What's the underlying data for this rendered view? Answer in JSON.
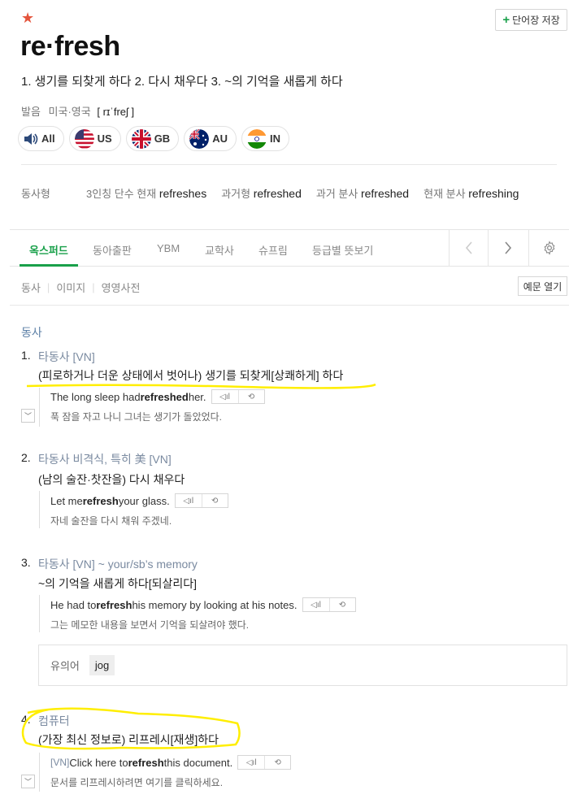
{
  "header": {
    "star": "★",
    "save_button": "단어장 저장",
    "save_plus": "+",
    "word": "re·fresh",
    "summary": "1. 생기를 되찾게 하다 2. 다시 채우다 3. ~의 기억을 새롭게 하다",
    "pron_label": "발음",
    "pron_region": "미국·영국",
    "pron_ipa": "[ rɪˈfreʃ ]",
    "audio": [
      {
        "label": "All",
        "icon": "speaker-icon"
      },
      {
        "label": "US",
        "icon": "us-flag-icon"
      },
      {
        "label": "GB",
        "icon": "gb-flag-icon"
      },
      {
        "label": "AU",
        "icon": "au-flag-icon"
      },
      {
        "label": "IN",
        "icon": "in-flag-icon"
      }
    ]
  },
  "verb_forms": {
    "label": "동사형",
    "items": [
      {
        "name": "3인칭 단수 현재",
        "value": "refreshes"
      },
      {
        "name": "과거형",
        "value": "refreshed"
      },
      {
        "name": "과거 분사",
        "value": "refreshed"
      },
      {
        "name": "현재 분사",
        "value": "refreshing"
      }
    ]
  },
  "tabs": [
    "옥스퍼드",
    "동아출판",
    "YBM",
    "교학사",
    "슈프림",
    "등급별 뜻보기"
  ],
  "active_tab": "옥스퍼드",
  "filters": [
    "동사",
    "이미지",
    "영영사전"
  ],
  "example_open": "예문 열기",
  "pos": "동사",
  "senses": [
    {
      "num": "1.",
      "head": "타동사 [VN]",
      "definition": "(피로하거나 더운 상태에서 벗어나) 생기를 되찾게[상쾌하게] 하다",
      "example_pre": "The long sleep had ",
      "example_bold": "refreshed",
      "example_post": " her.",
      "translation": "푹 잠을 자고 나니 그녀는 생기가 돌았었다."
    },
    {
      "num": "2.",
      "head": "타동사 비격식, 특히 美 [VN]",
      "definition": "(남의 술잔·찻잔을) 다시 채우다",
      "example_pre": "Let me ",
      "example_bold": "refresh",
      "example_post": " your glass.",
      "translation": "자네 술잔을 다시 채워 주겠네."
    },
    {
      "num": "3.",
      "head": "타동사 [VN] ~ your/sb’s memory",
      "definition": "~의 기억을 새롭게 하다[되살리다]",
      "example_pre": "He had to ",
      "example_bold": "refresh",
      "example_post": " his memory by looking at his notes.",
      "translation": "그는 메모한 내용을 보면서 기억을 되살려야 했다."
    },
    {
      "num": "4.",
      "head": "컴퓨터",
      "definition": "(가장 최신 정보로) 리프레시[재생]하다",
      "example_prefix": "[VN] ",
      "example_pre": "Click here to ",
      "example_bold": "refresh",
      "example_post": " this document.",
      "translation": "문서를 리프레시하려면 여기를 클릭하세요."
    }
  ],
  "synonym": {
    "label": "유의어",
    "word": "jog"
  },
  "colors": {
    "accent": "#19a04a",
    "star": "#e4543c",
    "highlight": "#ffee00"
  }
}
